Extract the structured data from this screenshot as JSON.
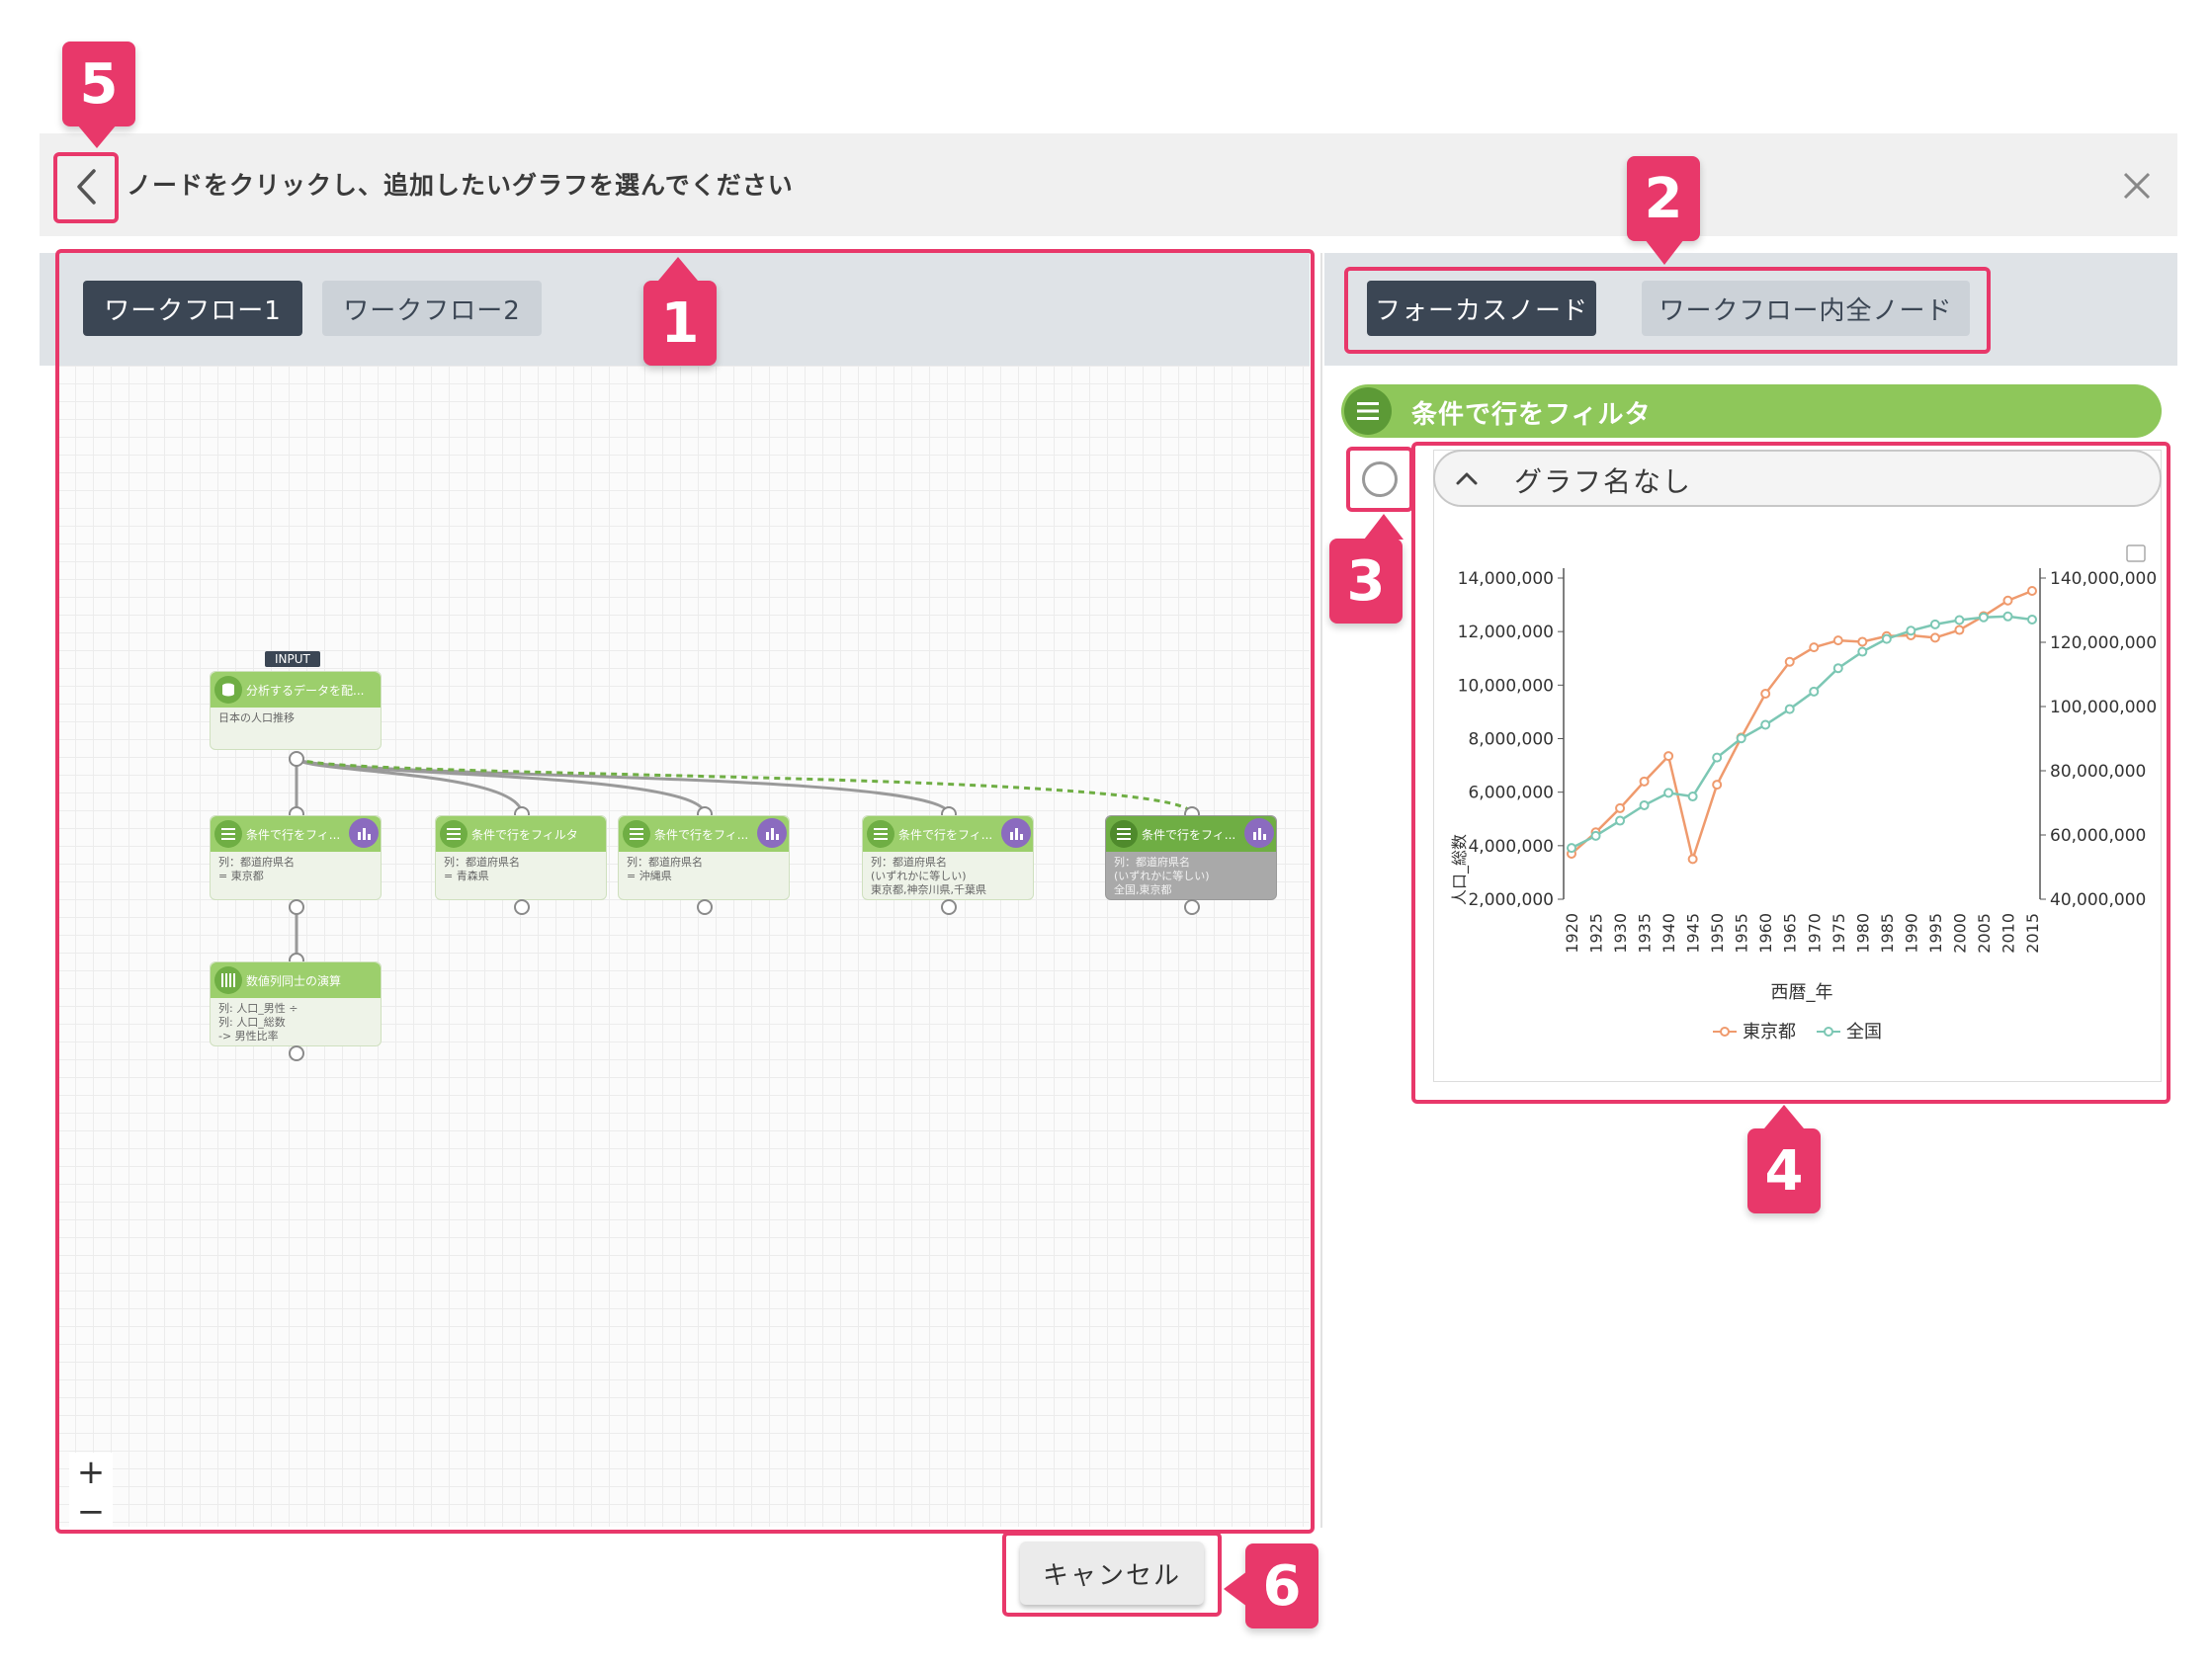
{
  "header": {
    "title": "ノードをクリックし、追加したいグラフを選んでください"
  },
  "workflow_tabs": [
    {
      "label": "ワークフロー1",
      "active": true
    },
    {
      "label": "ワークフロー2",
      "active": false
    }
  ],
  "zoom": {
    "in_label": "+",
    "out_label": "−"
  },
  "nodes": {
    "input_tag": "INPUT",
    "input_node": {
      "title": "分析するデータを配...",
      "body": [
        "日本の人口推移"
      ]
    },
    "filter1": {
      "title": "条件で行をフィ...",
      "body": [
        "列：都道府県名",
        "= 東京都"
      ]
    },
    "filter2": {
      "title": "条件で行をフィルタ",
      "body": [
        "列：都道府県名",
        "= 青森県"
      ]
    },
    "filter3": {
      "title": "条件で行をフィ...",
      "body": [
        "列：都道府県名",
        "= 沖縄県"
      ]
    },
    "filter4": {
      "title": "条件で行をフィ...",
      "body": [
        "列：都道府県名",
        "(いずれかに等しい)",
        "東京都,神奈川県,千葉県"
      ]
    },
    "filter5": {
      "title": "条件で行をフィ...",
      "body": [
        "列：都道府県名",
        "(いずれかに等しい)",
        "全国,東京都"
      ]
    },
    "calc": {
      "title": "数値列同士の演算",
      "body": [
        "列: 人口_男性 ÷",
        "列: 人口_総数",
        "-> 男性比率"
      ]
    }
  },
  "right_tabs": [
    {
      "label": "フォーカスノード",
      "active": true
    },
    {
      "label": "ワークフロー内全ノード",
      "active": false
    }
  ],
  "focus_node": {
    "title": "条件で行をフィルタ"
  },
  "graph": {
    "title": "グラフ名なし"
  },
  "chart_data": {
    "type": "line",
    "categories": [
      "1920",
      "1925",
      "1930",
      "1935",
      "1940",
      "1945",
      "1950",
      "1955",
      "1960",
      "1965",
      "1970",
      "1975",
      "1980",
      "1985",
      "1990",
      "1995",
      "2000",
      "2005",
      "2010",
      "2015"
    ],
    "xlabel": "西暦_年",
    "ylabel": "人口_総数",
    "ylim": [
      2000000,
      14000000
    ],
    "y2lim": [
      40000000,
      140000000
    ],
    "y_ticks": [
      "14,000,000",
      "12,000,000",
      "10,000,000",
      "8,000,000",
      "6,000,000",
      "4,000,000",
      "2,000,000"
    ],
    "y2_ticks": [
      "140,000,000",
      "120,000,000",
      "100,000,000",
      "80,000,000",
      "60,000,000",
      "40,000,000"
    ],
    "legend_position": "bottom",
    "series": [
      {
        "name": "東京都",
        "axis": "left",
        "color": "#ef9a6d",
        "values": [
          3700000,
          4500000,
          5400000,
          6400000,
          7350000,
          3500000,
          6280000,
          8040000,
          9680000,
          10870000,
          11410000,
          11670000,
          11620000,
          11830000,
          11860000,
          11770000,
          12060000,
          12580000,
          13160000,
          13520000
        ]
      },
      {
        "name": "全国",
        "axis": "right",
        "color": "#7cc7b4",
        "values": [
          55960000,
          59740000,
          64450000,
          69250000,
          73110000,
          71990000,
          84110000,
          90080000,
          94300000,
          99210000,
          104670000,
          111940000,
          117060000,
          121050000,
          123610000,
          125570000,
          126930000,
          127770000,
          128060000,
          127090000
        ]
      }
    ]
  },
  "footer": {
    "cancel_label": "キャンセル"
  },
  "annotations": [
    "1",
    "2",
    "3",
    "4",
    "5",
    "6"
  ],
  "colors": {
    "accent": "#e8386a",
    "dark_tab": "#3b4654",
    "node_green": "#9ccf6c",
    "chart_badge": "#8b6bbf"
  }
}
